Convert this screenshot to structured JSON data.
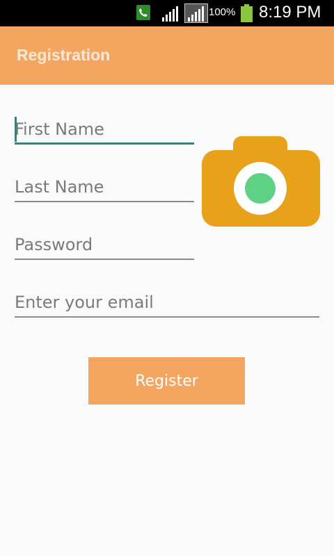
{
  "status_bar": {
    "battery_percent": "100%",
    "time": "8:19 PM",
    "icons": [
      "phone-call-icon",
      "signal-icon",
      "signal-icon-2",
      "battery-icon"
    ]
  },
  "app_bar": {
    "title": "Registration"
  },
  "form": {
    "first_name_placeholder": "First Name",
    "last_name_placeholder": "Last Name",
    "password_placeholder": "Password",
    "email_placeholder": "Enter your email",
    "register_label": "Register"
  },
  "colors": {
    "accent": "#f4a660",
    "focus": "#1f8a86",
    "camera_body": "#e8a11a",
    "camera_lens": "#5fd184"
  }
}
